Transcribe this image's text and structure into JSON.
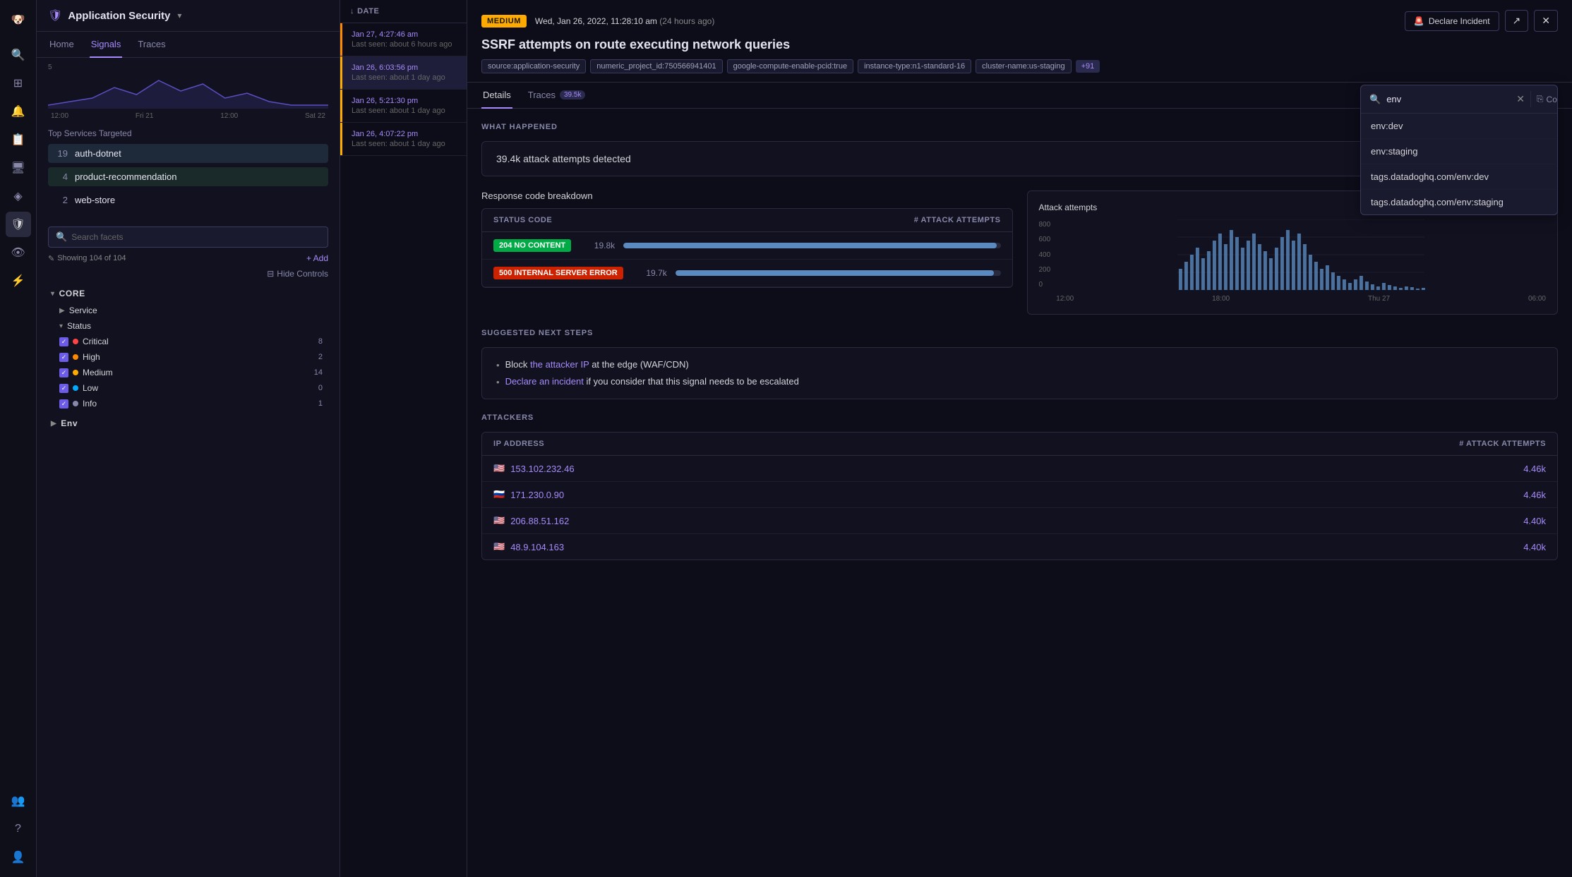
{
  "app": {
    "title": "Application Security",
    "icon": "shield"
  },
  "nav": {
    "tabs": [
      "Home",
      "Signals",
      "Traces"
    ],
    "active": "Signals"
  },
  "chart": {
    "y_max": "5",
    "y_min": "0",
    "x_labels": [
      "12:00",
      "Fri 21",
      "12:00",
      "Sat 22"
    ]
  },
  "top_services": {
    "title": "Top Services Targeted",
    "items": [
      {
        "count": 19,
        "name": "auth-dotnet"
      },
      {
        "count": 4,
        "name": "product-recommendation"
      },
      {
        "count": 2,
        "name": "web-store"
      }
    ]
  },
  "facets": {
    "search_placeholder": "Search facets",
    "count_label": "Showing 104 of 104",
    "add_label": "+ Add",
    "hide_controls_label": "Hide Controls",
    "groups": {
      "core": {
        "label": "CORE",
        "items": [
          {
            "label": "Service"
          },
          {
            "label": "Status",
            "expanded": true,
            "statuses": [
              {
                "name": "Critical",
                "count": 8,
                "dot": "critical"
              },
              {
                "name": "High",
                "count": 2,
                "dot": "high"
              },
              {
                "name": "Medium",
                "count": 14,
                "dot": "medium"
              },
              {
                "name": "Low",
                "count": 0,
                "dot": "low"
              },
              {
                "name": "Info",
                "count": 1,
                "dot": "info"
              }
            ]
          }
        ]
      },
      "env": {
        "label": "Env"
      }
    }
  },
  "signals": {
    "items": [
      {
        "date": "Jan 27, 4:27:46 am",
        "meta": "Last seen: about 6 hours ago",
        "severity": "high"
      },
      {
        "date": "Jan 26, 6:03:56 pm",
        "meta": "Last seen: about 1 day ago",
        "severity": "medium"
      },
      {
        "date": "Jan 26, 5:21:30 pm",
        "meta": "Last seen: about 1 day ago",
        "severity": "medium"
      },
      {
        "date": "Jan 26, 4:07:22 pm",
        "meta": "Last seen: about 1 day ago",
        "severity": "medium"
      }
    ]
  },
  "signal_detail": {
    "severity": "MEDIUM",
    "datetime": "Wed, Jan 26, 2022, 11:28:10 am",
    "time_ago": "(24 hours ago)",
    "title": "SSRF attempts on route executing network queries",
    "tags": [
      "source:application-security",
      "numeric_project_id:750566941401",
      "google-compute-enable-pcid:true",
      "instance-type:n1-standard-16",
      "cluster-name:us-staging",
      "+91"
    ],
    "declare_btn": "Declare Incident",
    "tabs": [
      {
        "label": "Details",
        "badge": null
      },
      {
        "label": "Traces",
        "badge": "39.5k"
      }
    ],
    "what_happened": {
      "title": "WHAT HAPPENED",
      "attack_summary": "39.4k attack attempts detected",
      "response_breakdown": {
        "title": "Response code breakdown",
        "columns": [
          "STATUS CODE",
          "# ATTACK ATTEMPTS"
        ],
        "rows": [
          {
            "code": "204 NO CONTENT",
            "type": "204",
            "count": "19.8k",
            "bar_pct": 99
          },
          {
            "code": "500 INTERNAL SERVER ERROR",
            "type": "500",
            "count": "19.7k",
            "bar_pct": 98
          }
        ]
      },
      "attack_chart": {
        "title": "Attack attempts",
        "y_labels": [
          "800",
          "600",
          "400",
          "200",
          "0"
        ],
        "x_labels": [
          "12:00",
          "18:00",
          "Thu 27",
          "06:00"
        ]
      }
    },
    "suggested_steps": {
      "title": "SUGGESTED NEXT STEPS",
      "steps": [
        {
          "text_before": "Block ",
          "link": "the attacker IP",
          "text_after": " at the edge (WAF/CDN)"
        },
        {
          "text_before": "",
          "link": "Declare an incident",
          "text_after": " if you consider that this signal needs to be escalated"
        }
      ]
    },
    "attackers": {
      "title": "ATTACKERS",
      "columns": [
        "IP ADDRESS",
        "# ATTACK ATTEMPTS"
      ],
      "rows": [
        {
          "flag": "🇺🇸",
          "ip": "153.102.232.46",
          "count": "4.46k"
        },
        {
          "flag": "🇷🇺",
          "ip": "171.230.0.90",
          "count": "4.46k"
        },
        {
          "flag": "🇺🇸",
          "ip": "206.88.51.162",
          "count": "4.40k"
        },
        {
          "flag": "🇺🇸",
          "ip": "48.9.104.163",
          "count": "4.40k"
        }
      ]
    }
  },
  "autocomplete": {
    "search_value": "env",
    "copy_label": "Copy",
    "items": [
      "env:dev",
      "env:staging",
      "tags.datadoghq.com/env:dev",
      "tags.datadoghq.com/env:staging"
    ]
  },
  "sidebar_icons": [
    {
      "name": "logo-icon",
      "symbol": "🐶"
    },
    {
      "name": "search-icon",
      "symbol": "🔍"
    },
    {
      "name": "dashboard-icon",
      "symbol": "⊞"
    },
    {
      "name": "monitor-icon",
      "symbol": "🔔"
    },
    {
      "name": "notebook-icon",
      "symbol": "📋"
    },
    {
      "name": "infrastructure-icon",
      "symbol": "🖥"
    },
    {
      "name": "apm-icon",
      "symbol": "◈"
    },
    {
      "name": "security-icon",
      "symbol": "🛡"
    },
    {
      "name": "rum-icon",
      "symbol": "👁"
    },
    {
      "name": "integrations-icon",
      "symbol": "⚡"
    },
    {
      "name": "team-icon",
      "symbol": "👥"
    },
    {
      "name": "help-icon",
      "symbol": "?"
    },
    {
      "name": "user-icon",
      "symbol": "👤"
    }
  ]
}
